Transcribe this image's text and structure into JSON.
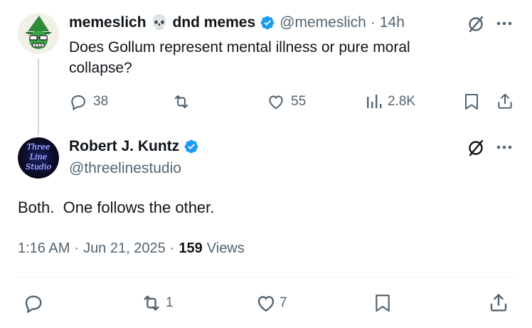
{
  "parent_tweet": {
    "author_name": "memeslich",
    "author_name_emoji": "💀",
    "author_name_suffix": "dnd memes",
    "handle": "@memeslich",
    "separator": "·",
    "time_ago": "14h",
    "text": "Does Gollum represent mental illness or pure moral collapse?",
    "replies": "38",
    "retweets": "",
    "likes": "55",
    "views": "2.8K"
  },
  "reply_tweet": {
    "author_name": "Robert J. Kuntz",
    "handle": "@threelinestudio",
    "avatar_text": [
      "Three",
      "Line",
      "Studio"
    ],
    "text": "Both.  One follows the other.",
    "time": "1:16 AM",
    "separator": "·",
    "date": "Jun 21, 2025",
    "separator2": "·",
    "views_count": "159",
    "views_label": "Views",
    "replies": "",
    "retweets": "1",
    "likes": "7"
  },
  "colors": {
    "verified": "#1d9bf0",
    "text": "#0f1419",
    "muted": "#536471",
    "line": "#cfd9de"
  }
}
